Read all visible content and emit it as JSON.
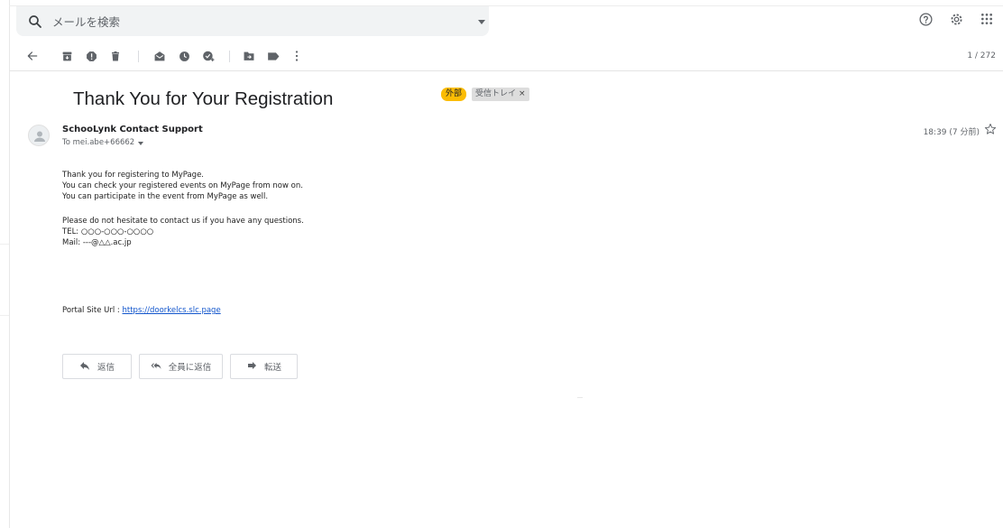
{
  "search": {
    "placeholder": "メールを検索"
  },
  "toolbar": {
    "pager": "1 / 272"
  },
  "email": {
    "subject": "Thank You for Your Registration",
    "labels": {
      "external": "外部",
      "inbox": "受信トレイ",
      "inbox_remove": "×"
    },
    "sender_name": "SchooLynk Contact Support",
    "recipient": "To mei.abe+66662",
    "timestamp": "18:39 (7 分前)",
    "body": {
      "line1": "Thank you for registering to MyPage.",
      "line2": "You can check your registered events on MyPage from now on.",
      "line3": "You can participate in the event from MyPage as well.",
      "line4": "Please do not hesitate to contact us if you have any questions.",
      "tel": "TEL: ○○○-○○○-○○○○",
      "mail": "Mail: ---@△△.ac.jp",
      "portal_label": "Portal Site Url : ",
      "portal_url": "https://doorkelcs.slc.page"
    }
  },
  "actions": {
    "reply": "返信",
    "reply_all": "全員に返信",
    "forward": "転送"
  },
  "icons": {
    "search": "search-icon",
    "help": "help-icon",
    "settings": "gear-icon",
    "apps": "apps-grid-icon",
    "back": "back-arrow-icon",
    "archive": "archive-icon",
    "spam": "report-spam-icon",
    "delete": "trash-icon",
    "mark_unread": "mark-unread-icon",
    "snooze": "snooze-clock-icon",
    "add_task": "add-task-icon",
    "move": "move-to-folder-icon",
    "label": "label-icon",
    "more": "more-vertical-icon",
    "star": "star-icon",
    "avatar": "person-avatar-icon"
  },
  "colors": {
    "external_label": "#fbbc04",
    "link": "#1155cc",
    "icon": "#5f6368"
  }
}
